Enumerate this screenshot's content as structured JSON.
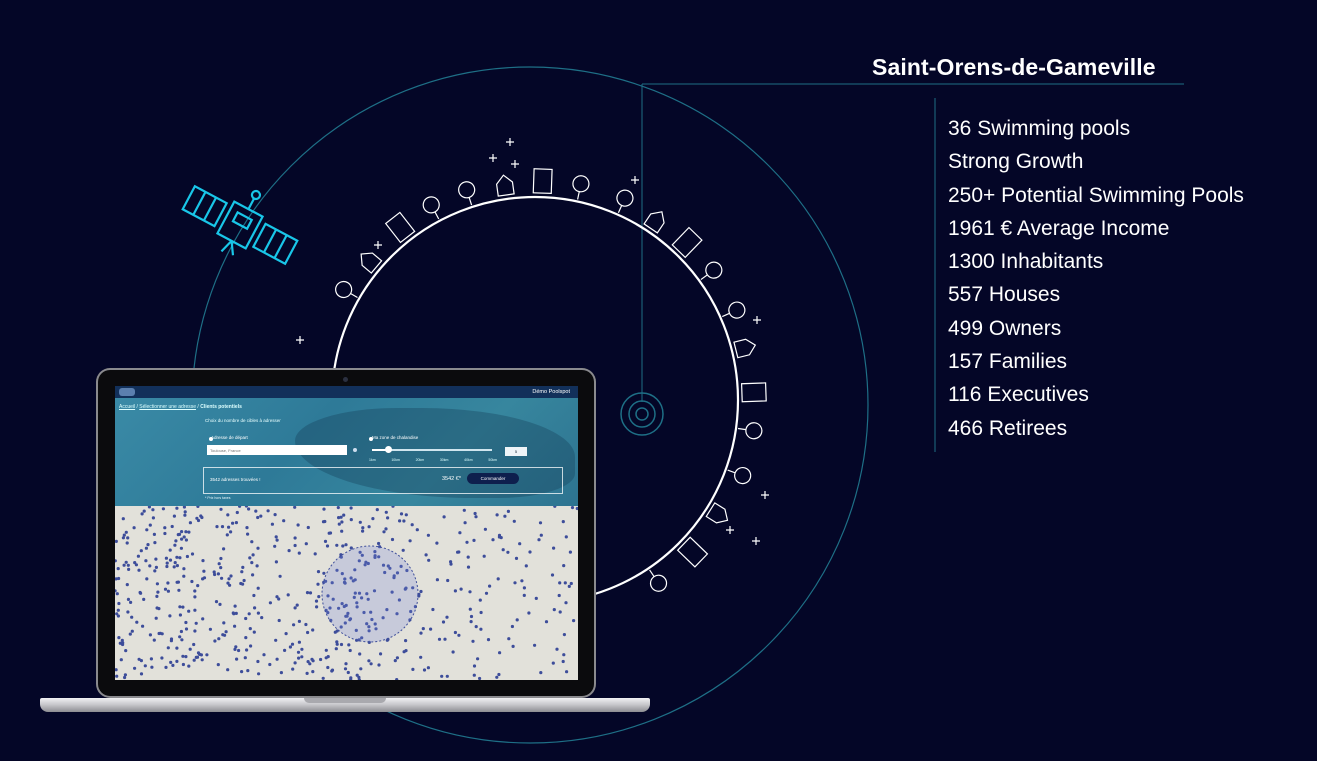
{
  "location": {
    "title": "Saint-Orens-de-Gameville"
  },
  "stats": [
    "36 Swimming pools",
    "Strong Growth",
    "250+  Potential Swimming Pools",
    "1961 € Average Income",
    "1300 Inhabitants",
    "557 Houses",
    "499 Owners",
    "157 Families",
    "116 Executives",
    "466 Retirees"
  ],
  "app": {
    "brand": "Démo Poolspot",
    "breadcrumbs": [
      "Accueil",
      "Sélectionner une adresse",
      "Clients potentiels"
    ],
    "hero_title": "Choix du nombre de cibles à adresser",
    "start_label": "Adresse de départ",
    "start_placeholder": "Toulouse, France",
    "zone_label": "Ma zone de chalandise",
    "radius_ticks": [
      "1km",
      "10km",
      "20km",
      "30km",
      "40km",
      "50km"
    ],
    "radius_value": "5",
    "result_count": "3542 adresses trouvées !",
    "result_price": "3542 €*",
    "order_button": "Commander",
    "tax_note": "* Prix hors taxes"
  },
  "colors": {
    "background": "#040627",
    "orbit_line": "#1e6f86",
    "satellite": "#19c6e8",
    "accent_button": "#0e1f4d",
    "map_dot": "#3d4d9a"
  },
  "icons": [
    "satellite-icon",
    "trees-icon",
    "house-icon",
    "building-icon",
    "factory-icon",
    "sparkle-icon",
    "target-icon"
  ]
}
